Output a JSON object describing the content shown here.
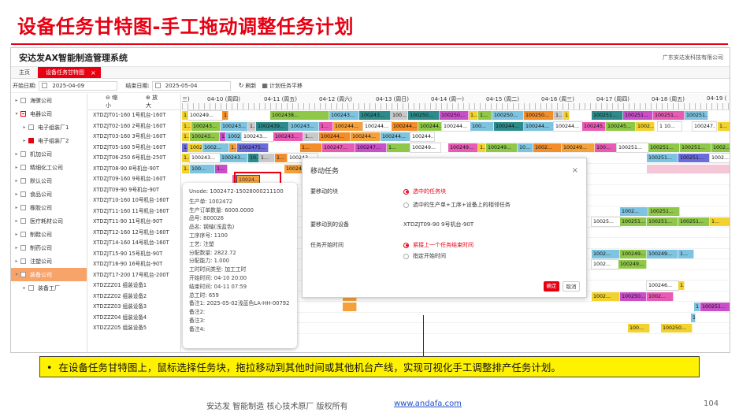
{
  "slide": {
    "title": "设备任务甘特图-手工拖动调整任务计划",
    "caption": "在设备任务甘特图上，鼠标选择任务块，拖拉移动到其他时间或其他机台产线，实现可视化手工调整排产任务计划。",
    "bullet": "•",
    "footer_company": "安达发   智能制造 核心技术原厂   版权所有",
    "footer_link": "www.andafa.com",
    "page_number": "104"
  },
  "app": {
    "title": "安达发AX智能制造管理系统",
    "company": "广东安达发科技有限公司",
    "tabs": [
      {
        "label": "主页"
      },
      {
        "label": "设备任务甘特图",
        "close": "×"
      }
    ]
  },
  "toolbar": {
    "start_label": "开始日期:",
    "start_value": "2025-04-09",
    "end_label": "结束日期:",
    "end_value": "2025-05-04",
    "refresh": "刷新",
    "plan": "计划任务平移",
    "zoom_out": "缩小",
    "zoom_in": "放大"
  },
  "tree": [
    {
      "label": "海骤公司",
      "state": "none",
      "arrow": "▸"
    },
    {
      "label": "电器公司",
      "state": "partial",
      "arrow": "▾"
    },
    {
      "label": "电子组装厂1",
      "state": "none",
      "arrow": "▸",
      "indent": 1
    },
    {
      "label": "电子组装厂2",
      "state": "checked",
      "arrow": "▸",
      "indent": 1
    },
    {
      "label": "机加公司",
      "state": "none",
      "arrow": "▸"
    },
    {
      "label": "精细化工公司",
      "state": "none",
      "arrow": "▸"
    },
    {
      "label": "默认公司",
      "state": "none",
      "arrow": "▸"
    },
    {
      "label": "食品公司",
      "state": "none",
      "arrow": "▸"
    },
    {
      "label": "橡胶公司",
      "state": "none",
      "arrow": "▸"
    },
    {
      "label": "医疗耗材公司",
      "state": "none",
      "arrow": "▸"
    },
    {
      "label": "制鞋公司",
      "state": "none",
      "arrow": "▸"
    },
    {
      "label": "制药公司",
      "state": "none",
      "arrow": "▸"
    },
    {
      "label": "注塑公司",
      "state": "none",
      "arrow": "▸"
    },
    {
      "label": "装备公司",
      "state": "none",
      "arrow": "▾",
      "selected": true
    },
    {
      "label": "装备工厂",
      "state": "none",
      "arrow": "▸",
      "indent": 1
    }
  ],
  "resources": [
    "XTDZJT01-160 1号机台-160T",
    "XTDZJT02-160 2号机台-160T",
    "XTDZJT03-160 3号机台-160T",
    "XTDZJT05-160 5号机台-160T",
    "XTDZJT06-250 6号机台-250T",
    "XTDZJT08-90 8号机台-90T",
    "XTDZJT09-160 9号机台-160T",
    "XTDZJT09-90 9号机台-90T",
    "XTDZJT10-160 10号机台-160T",
    "XTDZJT11-160 11号机台-160T",
    "XTDZJT11-90 11号机台-90T",
    "XTDZJT12-160 12号机台-160T",
    "XTDZJT14-160 14号机台-160T",
    "XTDZJT15-90 15号机台-90T",
    "XTDZJT16-90 16号机台-90T",
    "XTDZJT17-200 17号机台-200T",
    "XTDZZZ01 组装设备1",
    "XTDZZZ02 组装设备2",
    "XTDZZZ03 组装设备3",
    "XTDZZZ04 组装设备4",
    "XTDZZZ05 组装设备5"
  ],
  "days": [
    "三)",
    "04-10 (周四)",
    "04-11 (周五)",
    "04-12 (周六)",
    "04-13 (周日)",
    "04-14 (周一)",
    "04-15 (周二)",
    "04-16 (周三)",
    "04-17 (周四)",
    "04-18 (周五)",
    "04-19 ("
  ],
  "tasks": [
    [
      [
        0,
        8,
        "#f2d22e",
        "1..."
      ],
      [
        8,
        43,
        "#ffffff",
        "100249..."
      ],
      [
        51,
        8,
        "#f28d2a",
        "1..."
      ],
      [
        112,
        75,
        "#8fc848",
        "1002438..."
      ],
      [
        187,
        38,
        "#7ec3df",
        "100243..."
      ],
      [
        225,
        40,
        "#2e8b8b",
        "100243..."
      ],
      [
        265,
        22,
        "#c9c9c9",
        "100..."
      ],
      [
        287,
        40,
        "#2e8b8b",
        "100250..."
      ],
      [
        327,
        37,
        "#c94fc9",
        "100250..."
      ],
      [
        364,
        12,
        "#f2d22e",
        "1..."
      ],
      [
        376,
        18,
        "#8fc848",
        "1..."
      ],
      [
        394,
        40,
        "#7ec3df",
        "100250..."
      ],
      [
        434,
        38,
        "#f28d2a",
        "100250..."
      ],
      [
        472,
        12,
        "#c9c9c9",
        "1..."
      ],
      [
        484,
        8,
        "#f2d22e",
        "1..."
      ],
      [
        520,
        40,
        "#2e8b8b",
        "100251..."
      ],
      [
        560,
        38,
        "#c94fc9",
        "100251..."
      ],
      [
        598,
        40,
        "#e85bb5",
        "100251..."
      ],
      [
        638,
        30,
        "#7ec3df",
        "100251..."
      ]
    ],
    [
      [
        0,
        12,
        "#f2d22e",
        "1..."
      ],
      [
        12,
        37,
        "#8fc848",
        "100243..."
      ],
      [
        49,
        35,
        "#7ec3df",
        "100243..."
      ],
      [
        84,
        10,
        "#c9c9c9",
        "1..."
      ],
      [
        94,
        42,
        "#2e8b8b",
        "1002439..."
      ],
      [
        136,
        38,
        "#7ec3df",
        "100243..."
      ],
      [
        174,
        18,
        "#e85bb5",
        "1..."
      ],
      [
        192,
        38,
        "#f5a13b",
        "100244..."
      ],
      [
        230,
        36,
        "#ffffff",
        "100244..."
      ],
      [
        266,
        34,
        "#f28d2a",
        "100244..."
      ],
      [
        300,
        30,
        "#8fc848",
        "100244..."
      ],
      [
        330,
        36,
        "#ffffff",
        "100244..."
      ],
      [
        366,
        30,
        "#7ec3df",
        "100..."
      ],
      [
        396,
        38,
        "#2e8b8b",
        "100244..."
      ],
      [
        434,
        38,
        "#7ec3df",
        "100244..."
      ],
      [
        472,
        36,
        "#ffffff",
        "100244..."
      ],
      [
        508,
        30,
        "#e85bb5",
        "100245..."
      ],
      [
        538,
        38,
        "#8fc848",
        "100245..."
      ],
      [
        576,
        24,
        "#f2d22e",
        "1002..."
      ],
      [
        604,
        30,
        "#ffffff",
        "1 10..."
      ],
      [
        648,
        30,
        "#ffffff",
        "100247..."
      ],
      [
        680,
        17,
        "#f2d22e",
        "1..."
      ]
    ],
    [
      [
        0,
        10,
        "#f2d22e",
        "1..."
      ],
      [
        10,
        38,
        "#8fc848",
        "100243..."
      ],
      [
        48,
        8,
        "#c94fc9",
        "1..."
      ],
      [
        56,
        20,
        "#7ec3df",
        "1002..."
      ],
      [
        76,
        40,
        "#ffffff",
        "100243..."
      ],
      [
        116,
        38,
        "#e85bb5",
        "100243..."
      ],
      [
        154,
        20,
        "#c9c9c9",
        "1..."
      ],
      [
        174,
        40,
        "#f28d2a",
        "100244..."
      ],
      [
        214,
        38,
        "#f5a13b",
        "100244..."
      ],
      [
        252,
        38,
        "#7ec3df",
        "100244..."
      ],
      [
        290,
        30,
        "#ffffff",
        "100244..."
      ]
    ],
    [
      [
        0,
        8,
        "#6b6bdc",
        "1..."
      ],
      [
        8,
        18,
        "#f2d22e",
        "1002..."
      ],
      [
        26,
        34,
        "#7ec3df",
        "1002..."
      ],
      [
        60,
        10,
        "#f5a13b",
        "1..."
      ],
      [
        70,
        40,
        "#6b6bdc",
        "1002475..."
      ],
      [
        150,
        28,
        "#f28d2a",
        "1..."
      ],
      [
        178,
        42,
        "#e85bb5",
        "100247..."
      ],
      [
        220,
        40,
        "#c94fc9",
        "100247..."
      ],
      [
        260,
        30,
        "#8fc848",
        "1..."
      ],
      [
        290,
        38,
        "#ffffff",
        "100249..."
      ],
      [
        338,
        38,
        "#e85bb5",
        "100249..."
      ],
      [
        376,
        10,
        "#f2d22e",
        "1..."
      ],
      [
        386,
        40,
        "#8fc848",
        "100249..."
      ],
      [
        426,
        20,
        "#7ec3df",
        "10..."
      ],
      [
        446,
        36,
        "#f28d2a",
        "1002..."
      ],
      [
        482,
        42,
        "#f5a13b",
        "100249..."
      ],
      [
        524,
        28,
        "#e85bb5",
        "100..."
      ],
      [
        552,
        40,
        "#ffffff",
        "100251..."
      ],
      [
        592,
        40,
        "#8fc848",
        "100251..."
      ],
      [
        632,
        40,
        "#8fc848",
        "100251..."
      ],
      [
        672,
        25,
        "#8fc848",
        "1002..."
      ]
    ],
    [
      [
        0,
        10,
        "#f2d22e",
        "1..."
      ],
      [
        10,
        38,
        "#ffffff",
        "100243..."
      ],
      [
        48,
        36,
        "#7ec3df",
        "100243..."
      ],
      [
        84,
        14,
        "#2e8b8b",
        "10..."
      ],
      [
        98,
        20,
        "#c9c9c9",
        "1..."
      ],
      [
        118,
        16,
        "#f28d2a",
        "1..."
      ],
      [
        134,
        38,
        "#ffffff",
        "100243..."
      ],
      [
        590,
        40,
        "#7ec3df",
        "100251..."
      ],
      [
        630,
        40,
        "#6b6bdc",
        "100251..."
      ],
      [
        670,
        27,
        "#ffffff",
        "1002..."
      ]
    ],
    [
      [
        0,
        10,
        "#f2d22e",
        "1..."
      ],
      [
        10,
        32,
        "#7ec3df",
        "100..."
      ],
      [
        42,
        16,
        "#c94fc9",
        "1..."
      ],
      [
        130,
        36,
        "#f5a13b",
        "100247..."
      ],
      [
        590,
        107,
        "#f5c7d6",
        ""
      ]
    ],
    [
      [
        64,
        30,
        "#e85bb5",
        ""
      ]
    ],
    [],
    [],
    [
      [
        556,
        36,
        "#7ec3df",
        "1002..."
      ],
      [
        592,
        40,
        "#8fc848",
        "100251..."
      ]
    ],
    [
      [
        520,
        36,
        "#ffffff",
        "10025..."
      ],
      [
        556,
        34,
        "#8fc848",
        "100251..."
      ],
      [
        590,
        40,
        "#8fc848",
        "100251..."
      ],
      [
        630,
        40,
        "#8fc848",
        "100251..."
      ],
      [
        670,
        27,
        "#f2d22e",
        "1..."
      ]
    ],
    [],
    [],
    [
      [
        520,
        36,
        "#7ec3df",
        "1002..."
      ],
      [
        556,
        34,
        "#8fc848",
        "100249..."
      ],
      [
        590,
        40,
        "#7ec3df",
        "100249..."
      ],
      [
        630,
        20,
        "#7ec3df",
        "1..."
      ]
    ],
    [
      [
        520,
        34,
        "#ffffff",
        "1002..."
      ],
      [
        554,
        36,
        "#8fc848",
        "100249..."
      ]
    ],
    [],
    [
      [
        590,
        40,
        "#ffffff",
        "100246..."
      ],
      [
        630,
        8,
        "#f2d22e",
        "1..."
      ]
    ],
    [
      [
        204,
        18,
        "#f5a13b",
        ""
      ],
      [
        520,
        36,
        "#f2d22e",
        "1002..."
      ],
      [
        556,
        34,
        "#c94fc9",
        "100250..."
      ],
      [
        590,
        34,
        "#e85bb5",
        "1002..."
      ]
    ],
    [
      [
        204,
        18,
        "#f5a13b",
        ""
      ],
      [
        650,
        8,
        "#7ec3df",
        "1..."
      ],
      [
        658,
        40,
        "#c94fc9",
        "100251..."
      ]
    ],
    [
      [
        646,
        6,
        "#7ec3df",
        "1"
      ]
    ],
    [
      [
        566,
        28,
        "#f2d22e",
        "100..."
      ],
      [
        608,
        40,
        "#f2d22e",
        "100250..."
      ]
    ]
  ],
  "drag_task": {
    "label": "10024..."
  },
  "tooltip": {
    "lines": [
      "Unode:  1002472-15028000211100",
      "生产单:  1002472",
      "生产订单数量:  6000.0000",
      "品号:  800026",
      "品名:  钢轴(浅蓝色)",
      "工序序号:  1100",
      "工艺:  注塑",
      "分配数量:  2822.72",
      "分配能力:  1.000",
      "工时时间类型:  加工工时",
      "开始时间:  04-10 20:00",
      "结束时间:  04-11 07:59",
      "总工时:  659",
      "备注1:  2025-05-02浅蓝色LA-HH-00792",
      "备注2:",
      "备注3:",
      "备注4:"
    ]
  },
  "modal": {
    "title": "移动任务",
    "close": "×",
    "block_label": "要移动的块",
    "block_opt1": "选中的任务块",
    "block_opt2": "选中的生产单+工序+设备上的相邻任务",
    "device_label": "要移动到的设备",
    "device_value": "XTDZJT09-90 9号机台-90T",
    "time_label": "任务开始时间",
    "time_opt1": "紧接上一个任务结束时间",
    "time_opt2": "指定开始时间",
    "ok": "确定",
    "cancel": "取消"
  }
}
